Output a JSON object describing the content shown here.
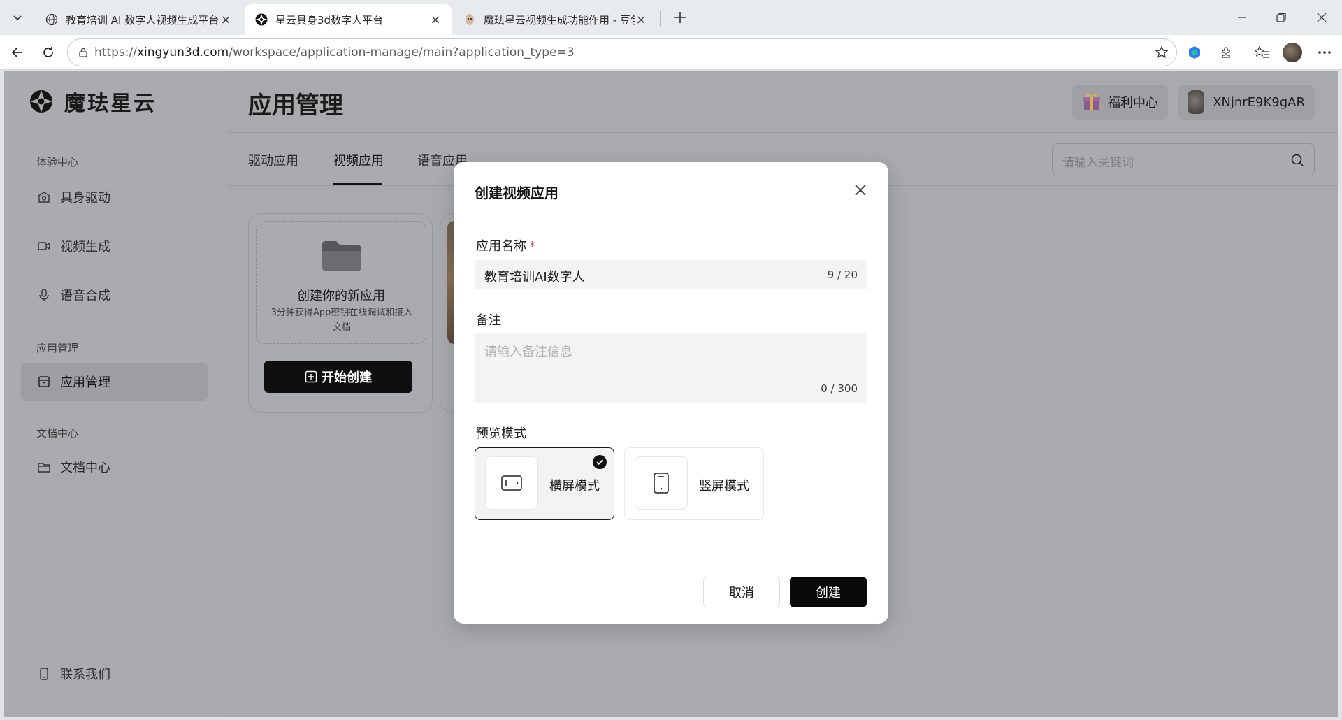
{
  "browser": {
    "tabs": [
      {
        "title": "教育培训 AI 数字人视频生成平台",
        "icon": "globe-icon"
      },
      {
        "title": "星云具身3d数字人平台",
        "icon": "site-logo-icon"
      },
      {
        "title": "魔珐星云视频生成功能作用 - 豆包",
        "icon": "doubao-icon"
      }
    ],
    "url_prefix": "https://",
    "url_host": "xingyun3d.com",
    "url_path": "/workspace/application-manage/main?application_type=3"
  },
  "sidebar": {
    "logo_text": "魔珐星云",
    "sections": [
      {
        "label": "体验中心",
        "items": [
          {
            "label": "具身驱动",
            "icon": "camera-icon"
          },
          {
            "label": "视频生成",
            "icon": "video-icon"
          },
          {
            "label": "语音合成",
            "icon": "microphone-icon"
          }
        ]
      },
      {
        "label": "应用管理",
        "items": [
          {
            "label": "应用管理",
            "icon": "archive-box-icon"
          }
        ]
      },
      {
        "label": "文档中心",
        "items": [
          {
            "label": "文档中心",
            "icon": "folder-icon"
          }
        ]
      }
    ],
    "contact": "联系我们"
  },
  "main": {
    "title": "应用管理",
    "welfare": "福利中心",
    "username": "XNjnrE9K9gAR",
    "subtabs": [
      "驱动应用",
      "视频应用",
      "语音应用"
    ],
    "search_placeholder": "请输入关键词",
    "create_card": {
      "title": "创建你的新应用",
      "desc": "3分钟获得App密钥在线调试和接入文档",
      "button": "开始创建"
    }
  },
  "modal": {
    "title": "创建视频应用",
    "name_label": "应用名称",
    "required_mark": "*",
    "name_value": "教育培训AI数字人",
    "name_counter": "9 / 20",
    "note_label": "备注",
    "note_placeholder": "请输入备注信息",
    "note_counter": "0 / 300",
    "preview_label": "预览模式",
    "modes": [
      {
        "label": "横屏模式",
        "selected": true
      },
      {
        "label": "竖屏模式",
        "selected": false
      }
    ],
    "cancel": "取消",
    "create": "创建"
  },
  "colors": {
    "accent": "#0a0a0a",
    "required": "#e5484d",
    "overlay": "#a8aaad"
  }
}
